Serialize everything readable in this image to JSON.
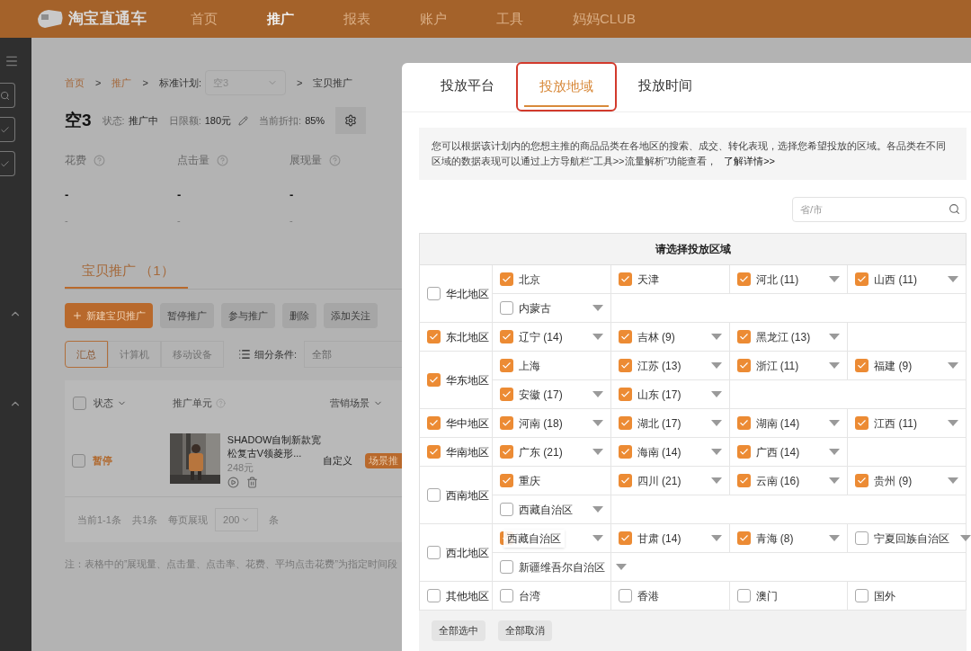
{
  "nav": {
    "logo": "淘宝直通车",
    "items": [
      {
        "label": "首页",
        "selected": false
      },
      {
        "label": "推广",
        "selected": true
      },
      {
        "label": "报表",
        "selected": false
      },
      {
        "label": "账户",
        "selected": false
      },
      {
        "label": "工具",
        "selected": false
      },
      {
        "label": "妈妈CLUB",
        "selected": false
      }
    ]
  },
  "breadcrumb": {
    "separator": ">",
    "links": [
      "首页",
      "推广"
    ],
    "plan_label": "标准计划:",
    "plan_value": "空3",
    "current": "宝贝推广"
  },
  "plan": {
    "name": "空3",
    "fields": [
      {
        "label": "状态:",
        "value": "推广中"
      },
      {
        "label": "日限额:",
        "value": "180元"
      },
      {
        "label": "当前折扣:",
        "value": "85%"
      }
    ]
  },
  "metrics": [
    {
      "label": "花费",
      "value": "-",
      "sub": "-"
    },
    {
      "label": "点击量",
      "value": "-",
      "sub": "-"
    },
    {
      "label": "展现量",
      "value": "-",
      "sub": "-"
    }
  ],
  "section_tab": "宝贝推广 （1）",
  "actions": [
    {
      "label": "新建宝贝推广",
      "kind": "primary"
    },
    {
      "label": "暂停推广",
      "kind": "plain"
    },
    {
      "label": "参与推广",
      "kind": "plain"
    },
    {
      "label": "删除",
      "kind": "plain"
    },
    {
      "label": "添加关注",
      "kind": "plain"
    }
  ],
  "segments": [
    {
      "label": "汇总",
      "selected": true
    },
    {
      "label": "计算机",
      "selected": false
    },
    {
      "label": "移动设备",
      "selected": false
    }
  ],
  "filter": {
    "label": "细分条件:",
    "value": "全部"
  },
  "table": {
    "all_checked": false,
    "columns": [
      "状态",
      "推广单元",
      "营销场景"
    ],
    "rows": [
      {
        "checked": false,
        "status": "暂停",
        "title": "SHADOW自制新款宽松复古V领菱形...",
        "price": "248元",
        "scene": "自定义",
        "tag": "场景推"
      }
    ]
  },
  "pagination": {
    "range": "当前1-1条",
    "total": "共1条",
    "per_page_label": "每页展现",
    "per_page": "200",
    "unit": "条"
  },
  "note": "注：表格中的”展现量、点击量、点击率、花费、平均点击花费”为指定时间段",
  "dialog": {
    "tabs": [
      {
        "label": "投放平台",
        "selected": false
      },
      {
        "label": "投放地域",
        "selected": true
      },
      {
        "label": "投放时间",
        "selected": false
      }
    ],
    "info": "您可以根据该计划内的您想主推的商品品类在各地区的搜索、成交、转化表现，选择您希望投放的区域。各品类在不同区域的数据表现可以通过上方导航栏“工具>>流量解析”功能查看，",
    "info_link": "了解详情>>",
    "search": {
      "placeholder": "省/市"
    },
    "table_title": "请选择投放区域",
    "regions": [
      {
        "name": "华北地区",
        "checked": false,
        "provinces": [
          {
            "label": "北京",
            "checked": true,
            "dropdown": false
          },
          {
            "label": "天津",
            "checked": true,
            "dropdown": false
          },
          {
            "label": "河北 (11)",
            "checked": true,
            "dropdown": true
          },
          {
            "label": "山西 (11)",
            "checked": true,
            "dropdown": true
          },
          {
            "label": "内蒙古",
            "checked": false,
            "dropdown": true
          }
        ]
      },
      {
        "name": "东北地区",
        "checked": true,
        "provinces": [
          {
            "label": "辽宁 (14)",
            "checked": true,
            "dropdown": true
          },
          {
            "label": "吉林 (9)",
            "checked": true,
            "dropdown": true
          },
          {
            "label": "黑龙江 (13)",
            "checked": true,
            "dropdown": true
          }
        ]
      },
      {
        "name": "华东地区",
        "checked": true,
        "provinces": [
          {
            "label": "上海",
            "checked": true,
            "dropdown": false
          },
          {
            "label": "江苏 (13)",
            "checked": true,
            "dropdown": true
          },
          {
            "label": "浙江 (11)",
            "checked": true,
            "dropdown": true
          },
          {
            "label": "福建 (9)",
            "checked": true,
            "dropdown": true
          },
          {
            "label": "安徽 (17)",
            "checked": true,
            "dropdown": true
          },
          {
            "label": "山东 (17)",
            "checked": true,
            "dropdown": true
          }
        ]
      },
      {
        "name": "华中地区",
        "checked": true,
        "provinces": [
          {
            "label": "河南 (18)",
            "checked": true,
            "dropdown": true
          },
          {
            "label": "湖北 (17)",
            "checked": true,
            "dropdown": true
          },
          {
            "label": "湖南 (14)",
            "checked": true,
            "dropdown": true
          },
          {
            "label": "江西 (11)",
            "checked": true,
            "dropdown": true
          }
        ]
      },
      {
        "name": "华南地区",
        "checked": true,
        "provinces": [
          {
            "label": "广东 (21)",
            "checked": true,
            "dropdown": true
          },
          {
            "label": "海南 (14)",
            "checked": true,
            "dropdown": true
          },
          {
            "label": "广西 (14)",
            "checked": true,
            "dropdown": true
          }
        ]
      },
      {
        "name": "西南地区",
        "checked": false,
        "provinces": [
          {
            "label": "重庆",
            "checked": true,
            "dropdown": false
          },
          {
            "label": "四川 (21)",
            "checked": true,
            "dropdown": true
          },
          {
            "label": "云南 (16)",
            "checked": true,
            "dropdown": true
          },
          {
            "label": "贵州 (9)",
            "checked": true,
            "dropdown": true
          },
          {
            "label": "西藏自治区",
            "checked": false,
            "dropdown": true
          }
        ]
      },
      {
        "name": "西北地区",
        "checked": false,
        "provinces": [
          {
            "tooltip": "西藏自治区",
            "checked": true,
            "dropdown": true
          },
          {
            "label": "甘肃 (14)",
            "checked": true,
            "dropdown": true
          },
          {
            "label": "青海 (8)",
            "checked": true,
            "dropdown": true
          },
          {
            "label": "宁夏回族自治区",
            "checked": false,
            "dropdown": true
          },
          {
            "label": "新疆维吾尔自治区",
            "checked": false,
            "dropdown": true
          }
        ]
      },
      {
        "name": "其他地区",
        "checked": false,
        "provinces": [
          {
            "label": "台湾",
            "checked": false,
            "dropdown": false
          },
          {
            "label": "香港",
            "checked": false,
            "dropdown": false
          },
          {
            "label": "澳门",
            "checked": false,
            "dropdown": false
          },
          {
            "label": "国外",
            "checked": false,
            "dropdown": false
          }
        ]
      }
    ],
    "footer_buttons": [
      "全部选中",
      "全部取消"
    ]
  }
}
